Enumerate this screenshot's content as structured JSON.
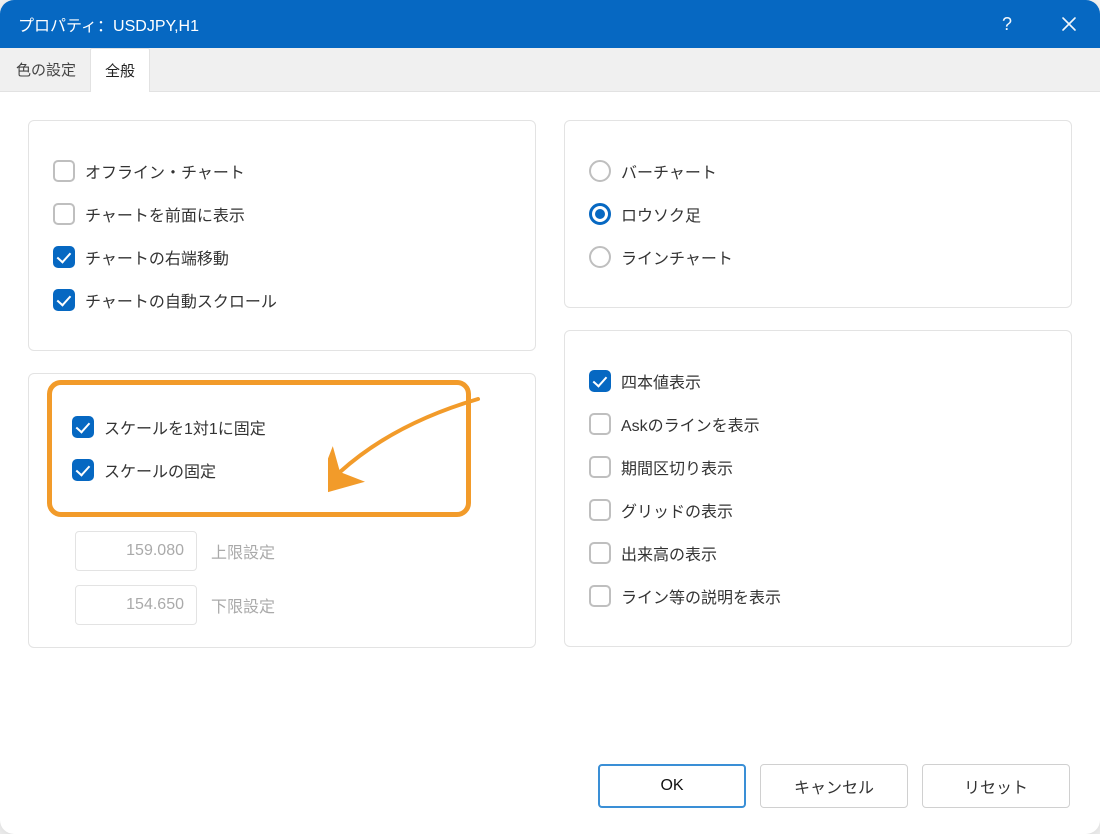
{
  "titlebar": {
    "title": "プロパティ：USDJPY,H1",
    "help_label": "?",
    "close_label": "×"
  },
  "tabs": {
    "colors": "色の設定",
    "general": "全般"
  },
  "left": {
    "group1": {
      "offline_chart": "オフライン・チャート",
      "chart_to_front": "チャートを前面に表示",
      "right_shift": "チャートの右端移動",
      "auto_scroll": "チャートの自動スクロール"
    },
    "highlight": {
      "fix_scale_one_to_one": "スケールを1対1に固定",
      "fix_scale": "スケールの固定"
    },
    "upper_value": "159.080",
    "upper_label": "上限設定",
    "lower_value": "154.650",
    "lower_label": "下限設定"
  },
  "right": {
    "chart_type": {
      "bar": "バーチャート",
      "candle": "ロウソク足",
      "line": "ラインチャート"
    },
    "display": {
      "ohlc": "四本値表示",
      "ask_line": "Askのラインを表示",
      "period_sep": "期間区切り表示",
      "grid": "グリッドの表示",
      "volume": "出来高の表示",
      "object_desc": "ライン等の説明を表示"
    }
  },
  "footer": {
    "ok": "OK",
    "cancel": "キャンセル",
    "reset": "リセット"
  },
  "checked": {
    "right_shift": true,
    "auto_scroll": true,
    "fix_scale_one_to_one": true,
    "fix_scale": true,
    "candle": true,
    "ohlc": true
  },
  "colors": {
    "accent": "#0668c2",
    "highlight": "#f29b2a"
  }
}
